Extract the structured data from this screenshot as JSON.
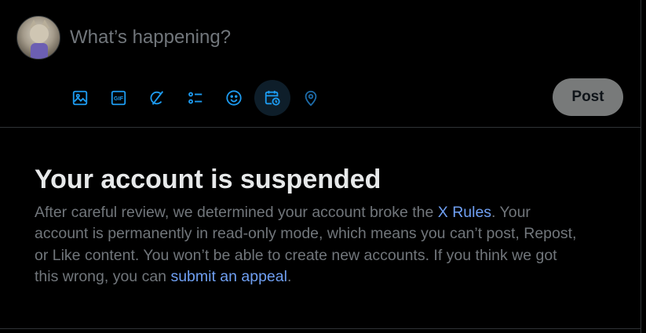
{
  "composer": {
    "prompt_placeholder": "What’s happening?",
    "post_label": "Post",
    "tools": [
      {
        "icon": "image-icon"
      },
      {
        "icon": "gif-icon",
        "label": "GIF"
      },
      {
        "icon": "grok-icon"
      },
      {
        "icon": "poll-icon"
      },
      {
        "icon": "emoji-icon"
      },
      {
        "icon": "schedule-icon"
      },
      {
        "icon": "location-icon"
      }
    ],
    "accent_color": "#1d9bf0"
  },
  "suspension": {
    "title": "Your account is suspended",
    "body_part1": "After careful review, we determined your account broke the ",
    "rules_link": "X Rules",
    "body_part2": ". Your account is permanently in read-only mode, which means you can’t post, Repost, or Like content. You won’t be able to create new accounts. If you think we got this wrong, you can ",
    "appeal_link": "submit an appeal",
    "body_part3": "."
  }
}
